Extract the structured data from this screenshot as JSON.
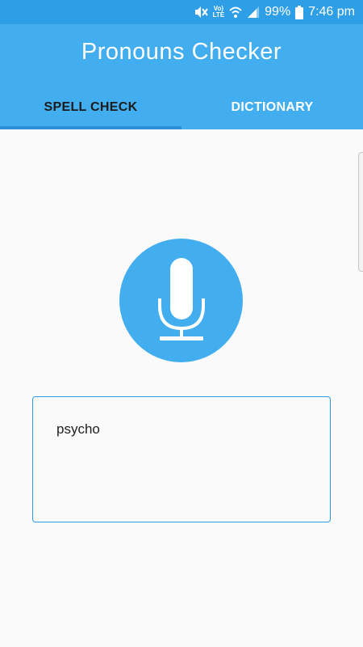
{
  "status_bar": {
    "volte_label": "Vo)\nLTE",
    "battery": "99%",
    "time": "7:46 pm",
    "icons": [
      "mute-icon",
      "volte-icon",
      "wifi-icon",
      "signal-icon",
      "battery-icon"
    ]
  },
  "app": {
    "title": "Pronouns Checker"
  },
  "tabs": [
    {
      "label": "SPELL CHECK",
      "active": true
    },
    {
      "label": "DICTIONARY",
      "active": false
    }
  ],
  "mic": {
    "icon": "microphone-icon"
  },
  "input": {
    "value": "psycho"
  },
  "colors": {
    "status_bar": "#2e9ee6",
    "app_bar": "#42aeef",
    "tab_indicator": "#2a8fd6",
    "input_border": "#2a9ce6",
    "background": "#fafafa"
  }
}
